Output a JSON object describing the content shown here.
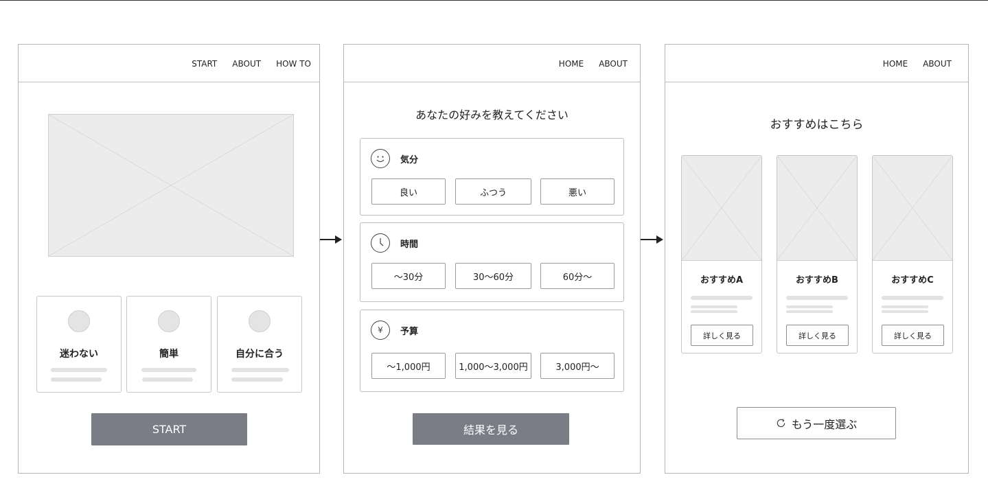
{
  "screen1": {
    "nav": [
      "START",
      "ABOUT",
      "HOW TO"
    ],
    "features": [
      {
        "label": "迷わない"
      },
      {
        "label": "簡単"
      },
      {
        "label": "自分に合う"
      }
    ],
    "start_label": "START"
  },
  "screen2": {
    "nav": [
      "HOME",
      "ABOUT"
    ],
    "heading": "あなたの好みを教えてください",
    "groups": [
      {
        "icon": "smiley-icon",
        "label": "気分",
        "options": [
          "良い",
          "ふつう",
          "悪い"
        ]
      },
      {
        "icon": "clock-icon",
        "label": "時間",
        "options": [
          "〜30分",
          "30〜60分",
          "60分〜"
        ]
      },
      {
        "icon": "yen-icon",
        "glyph": "¥",
        "label": "予算",
        "options": [
          "〜1,000円",
          "1,000〜3,000円",
          "3,000円〜"
        ]
      }
    ],
    "result_label": "結果を見る"
  },
  "screen3": {
    "nav": [
      "HOME",
      "ABOUT"
    ],
    "heading": "おすすめはこちら",
    "cards": [
      {
        "title": "おすすめA",
        "button": "詳しく見る"
      },
      {
        "title": "おすすめB",
        "button": "詳しく見る"
      },
      {
        "title": "おすすめC",
        "button": "詳しく見る"
      }
    ],
    "again_icon": "refresh-icon",
    "again_label": "もう一度選ぶ"
  }
}
